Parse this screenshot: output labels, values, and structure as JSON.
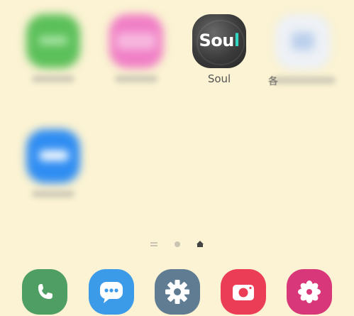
{
  "home": {
    "apps": [
      {
        "id": "app-1",
        "label": ""
      },
      {
        "id": "app-2",
        "label": ""
      },
      {
        "id": "app-soul",
        "label": "Soul",
        "icon_text_main": "Sou",
        "icon_text_accent": "l"
      },
      {
        "id": "app-4",
        "label": "",
        "label_prefix": "各"
      },
      {
        "id": "app-5",
        "label": ""
      }
    ]
  },
  "page_indicator": {
    "pages": [
      "menu",
      "page",
      "home"
    ],
    "active": "home"
  },
  "dock": {
    "items": [
      {
        "name": "phone",
        "icon": "phone-icon",
        "color": "#4f9e63"
      },
      {
        "name": "messages",
        "icon": "message-icon",
        "color": "#3b9be8"
      },
      {
        "name": "settings",
        "icon": "gear-icon",
        "color": "#607c93"
      },
      {
        "name": "camera",
        "icon": "camera-icon",
        "color": "#eb3e56"
      },
      {
        "name": "gallery",
        "icon": "flower-icon",
        "color": "#d8377a"
      }
    ]
  },
  "colors": {
    "wallpaper": "#fbf3d3",
    "soul_accent": "#35d6c1"
  }
}
